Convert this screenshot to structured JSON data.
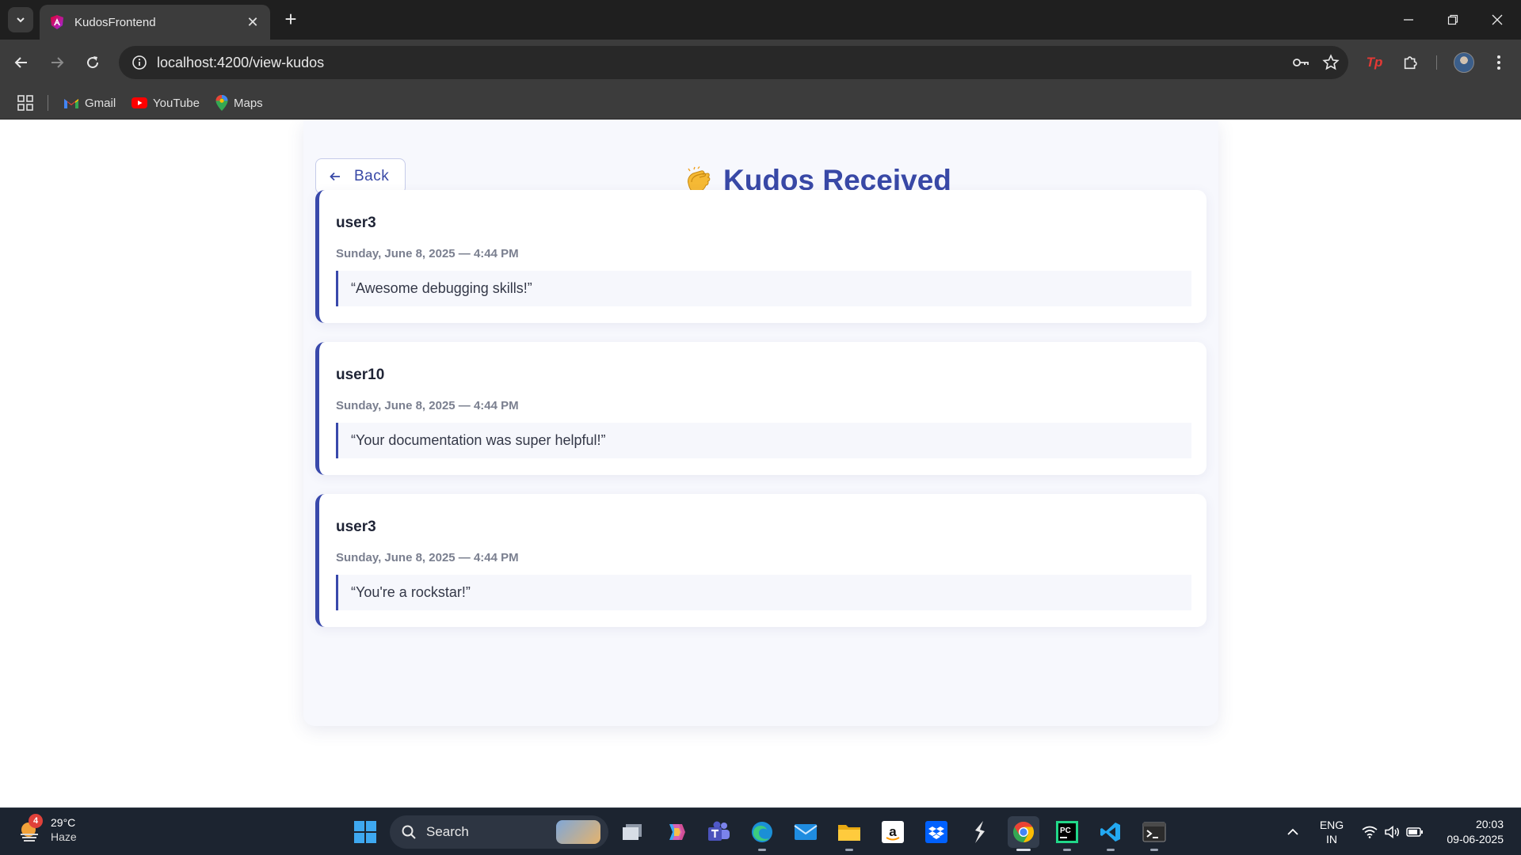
{
  "browser": {
    "tab_title": "KudosFrontend",
    "url": "localhost:4200/view-kudos",
    "bookmarks": [
      {
        "label": "Gmail",
        "icon": "gmail-icon"
      },
      {
        "label": "YouTube",
        "icon": "youtube-icon"
      },
      {
        "label": "Maps",
        "icon": "maps-icon"
      }
    ]
  },
  "page": {
    "back_label": "Back",
    "title": "Kudos Received",
    "title_emoji": "clapping-hands",
    "accent_color": "#3949ab",
    "kudos": [
      {
        "user": "user3",
        "date": "Sunday, June 8, 2025 — 4:44 PM",
        "message": "“Awesome debugging skills!”"
      },
      {
        "user": "user10",
        "date": "Sunday, June 8, 2025 — 4:44 PM",
        "message": "“Your documentation was super helpful!”"
      },
      {
        "user": "user3",
        "date": "Sunday, June 8, 2025 — 4:44 PM",
        "message": "“You're a rockstar!”"
      }
    ]
  },
  "taskbar": {
    "weather": {
      "badge": "4",
      "temp": "29°C",
      "condition": "Haze"
    },
    "search_label": "Search",
    "apps": [
      "file-explorer-window-icon",
      "copilot-icon",
      "teams-icon",
      "edge-icon",
      "mail-icon",
      "folder-icon",
      "amazon-icon",
      "dropbox-icon",
      "terminal-app-icon",
      "chrome-icon",
      "pycharm-icon",
      "vscode-icon",
      "windows-terminal-icon"
    ],
    "active_app": "chrome-icon",
    "tray": {
      "lang_top": "ENG",
      "lang_bottom": "IN",
      "time": "20:03",
      "date": "09-06-2025"
    }
  }
}
